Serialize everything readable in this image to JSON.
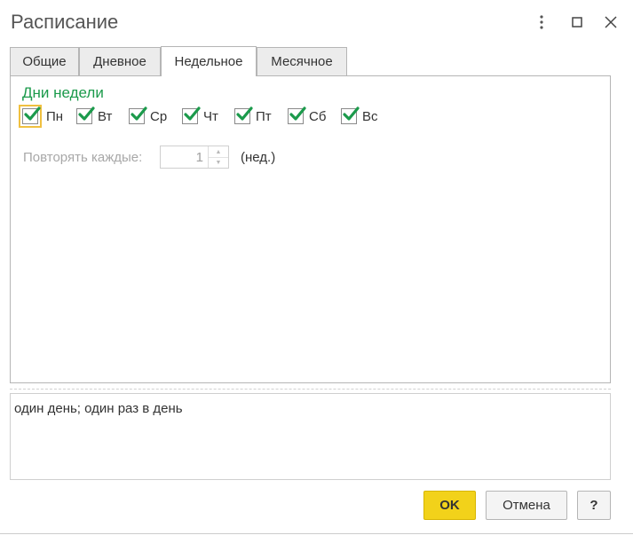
{
  "window": {
    "title": "Расписание",
    "controls": [
      "more-vertical-icon",
      "maximize-icon",
      "close-icon"
    ]
  },
  "tabs": [
    {
      "label": "Общие",
      "active": false
    },
    {
      "label": "Дневное",
      "active": false
    },
    {
      "label": "Недельное",
      "active": true
    },
    {
      "label": "Месячное",
      "active": false
    }
  ],
  "weekdays": {
    "title": "Дни недели",
    "days": [
      {
        "label": "Пн",
        "checked": true,
        "focused": true
      },
      {
        "label": "Вт",
        "checked": true
      },
      {
        "label": "Ср",
        "checked": true
      },
      {
        "label": "Чт",
        "checked": true
      },
      {
        "label": "Пт",
        "checked": true
      },
      {
        "label": "Сб",
        "checked": true
      },
      {
        "label": "Вс",
        "checked": true
      }
    ]
  },
  "repeat": {
    "label": "Повторять каждые:",
    "value": "1",
    "unit": "(нед.)",
    "enabled": false
  },
  "summary": {
    "text": "один день; один раз в день"
  },
  "buttons": {
    "ok": "OK",
    "cancel": "Отмена",
    "help": "?"
  },
  "colors": {
    "accent_green": "#1b9a4b",
    "ok_yellow": "#f2d21a",
    "focus_outline": "#f0c040"
  }
}
